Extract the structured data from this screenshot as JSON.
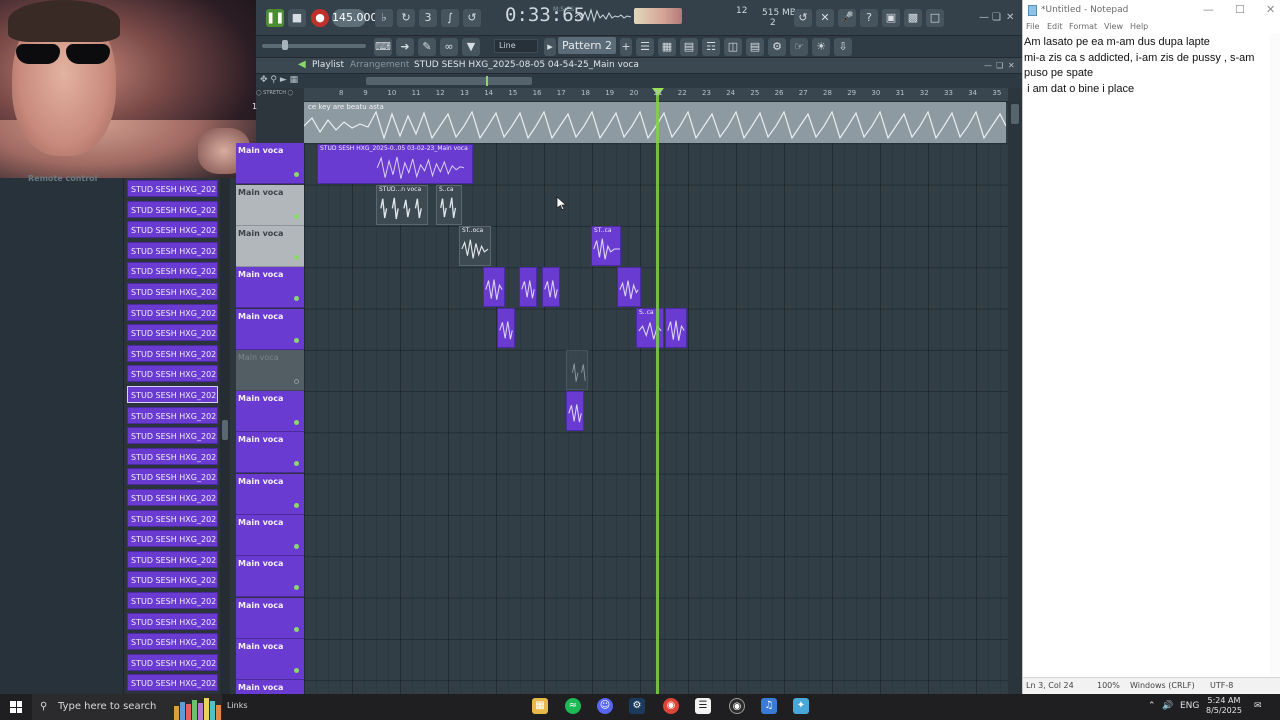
{
  "fl": {
    "tempo": "145.000",
    "time": "0:33:65",
    "time_label": "M:S:CS",
    "cpu": "12",
    "memory": "515 MB",
    "voices": "2",
    "snap": "Line",
    "pattern": "Pattern 2",
    "playlist_title": "Playlist",
    "playlist_sub": "Arrangement",
    "playlist_name": "STUD SESH HXG_2025-08-05 04-54-25_Main voca",
    "browser_label": "Remote control",
    "ruler": [
      "8",
      "9",
      "10",
      "11",
      "12",
      "13",
      "14",
      "15",
      "16",
      "17",
      "18",
      "19",
      "20",
      "21",
      "22",
      "23",
      "24",
      "25",
      "26",
      "27",
      "28",
      "29",
      "30",
      "31",
      "32",
      "33",
      "34",
      "35"
    ],
    "top_track_label": "ce key are beatu asta",
    "clip_list": [
      "STUD SESH HXG_2025-08...",
      "STUD SESH HXG_2025-08...",
      "STUD SESH HXG_2025-08...",
      "STUD SESH HXG_2025-08...",
      "STUD SESH HXG_2025-08...",
      "STUD SESH HXG_2025-08...",
      "STUD SESH HXG_2025-08...",
      "STUD SESH HXG_2025-08...",
      "STUD SESH HXG_2025-08...",
      "STUD SESH HXG_2025-08...",
      "STUD SESH HXG_2025-08...",
      "STUD SESH HXG_2025-08...",
      "STUD SESH HXG_2025-08...",
      "STUD SESH HXG_2025-08...",
      "STUD SESH HXG_2025-08...",
      "STUD SESH HXG_2025-08...",
      "STUD SESH HXG_2025-08...",
      "STUD SESH HXG_2025-08...",
      "STUD SESH HXG_2025-08...",
      "STUD SESH HXG_2025-08...",
      "STUD SESH HXG_2025-08...",
      "STUD SESH HXG_2025-08...",
      "STUD SESH HXG_2025-08...",
      "STUD SESH HXG_2025-08...",
      "STUD SESH HXG_2025-08..."
    ],
    "tracks": [
      {
        "label": "Main voca",
        "style": "purple"
      },
      {
        "label": "Main voca",
        "style": "grey"
      },
      {
        "label": "Main voca",
        "style": "grey"
      },
      {
        "label": "Main voca",
        "style": "purple"
      },
      {
        "label": "Main voca",
        "style": "purple"
      },
      {
        "label": "Main voca",
        "style": "dim"
      },
      {
        "label": "Main voca",
        "style": "purple"
      },
      {
        "label": "Main voca",
        "style": "purple"
      },
      {
        "label": "Main voca",
        "style": "purple"
      },
      {
        "label": "Main voca",
        "style": "purple"
      },
      {
        "label": "Main voca",
        "style": "purple"
      },
      {
        "label": "Main voca",
        "style": "purple"
      },
      {
        "label": "Main voca",
        "style": "purple"
      },
      {
        "label": "Main voca",
        "style": "purple"
      }
    ],
    "clip_labels": {
      "c1": "STUD SESH HXG_2025-0..05 03-02-23_Main voca",
      "c2": "STUD...n voca",
      "c3": "S..ca",
      "c4": "ST..oca",
      "c5": "ST..ca",
      "c6": "S..ca"
    }
  },
  "notepad": {
    "title": "*Untitled - Notepad",
    "menu": [
      "File",
      "Edit",
      "Format",
      "View",
      "Help"
    ],
    "text": "Am lasato pe ea m-am dus dupa lapte\nmi-a zis ca s addicted, i-am zis de pussy , s-am puso pe spate\n i am dat o bine i place",
    "status_pos": "Ln 3, Col 24",
    "status_zoom": "100%",
    "status_eol": "Windows (CRLF)",
    "status_enc": "UTF-8"
  },
  "taskbar": {
    "search_placeholder": "Type here to search",
    "links": "Links",
    "lang": "ENG",
    "time": "5:24 AM",
    "date": "8/5/2025"
  }
}
